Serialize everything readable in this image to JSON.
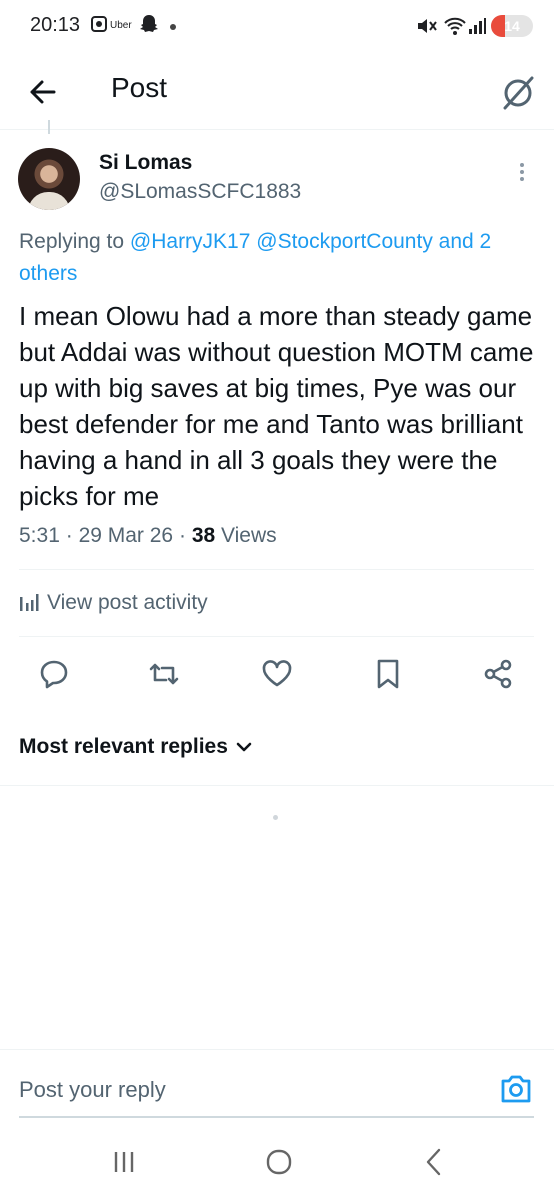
{
  "status_bar": {
    "time": "20:13",
    "uber_label": "Uber",
    "battery": "14",
    "battery_color": "#e94b3c"
  },
  "header": {
    "title": "Post",
    "back_icon": "arrow-left-icon",
    "grok_icon": "grok-icon"
  },
  "post": {
    "author_name": "Si Lomas",
    "author_handle": "@SLomasSCFC1883",
    "replying_prefix": "Replying to",
    "replying_mentions": "@HarryJK17 @StockportCounty and 2 others",
    "text": "I mean Olowu had a more than steady game but Addai was without question MOTM came up with big saves at big times, Pye was our best defender for me and Tanto was brilliant having a hand in all 3 goals they were the picks for me",
    "time": "5:31",
    "date": "29 Mar 26",
    "views_count": "38",
    "views_label": "Views",
    "separator": "·",
    "link_color": "#1d9bf0"
  },
  "activity": {
    "label": "View post activity",
    "icon": "bar-chart-icon"
  },
  "actions": [
    {
      "name": "reply",
      "icon": "reply-bubble-icon"
    },
    {
      "name": "repost",
      "icon": "repost-icon"
    },
    {
      "name": "like",
      "icon": "heart-icon"
    },
    {
      "name": "bookmark",
      "icon": "bookmark-icon"
    },
    {
      "name": "share",
      "icon": "share-icon"
    }
  ],
  "replies": {
    "sort_label": "Most relevant replies"
  },
  "composer": {
    "placeholder": "Post your reply",
    "camera_icon": "camera-icon",
    "accent_color": "#1d9bf0"
  },
  "system_nav": {
    "recent_icon": "recent-apps-icon",
    "home_icon": "home-circle-icon",
    "back_icon": "nav-back-icon"
  }
}
